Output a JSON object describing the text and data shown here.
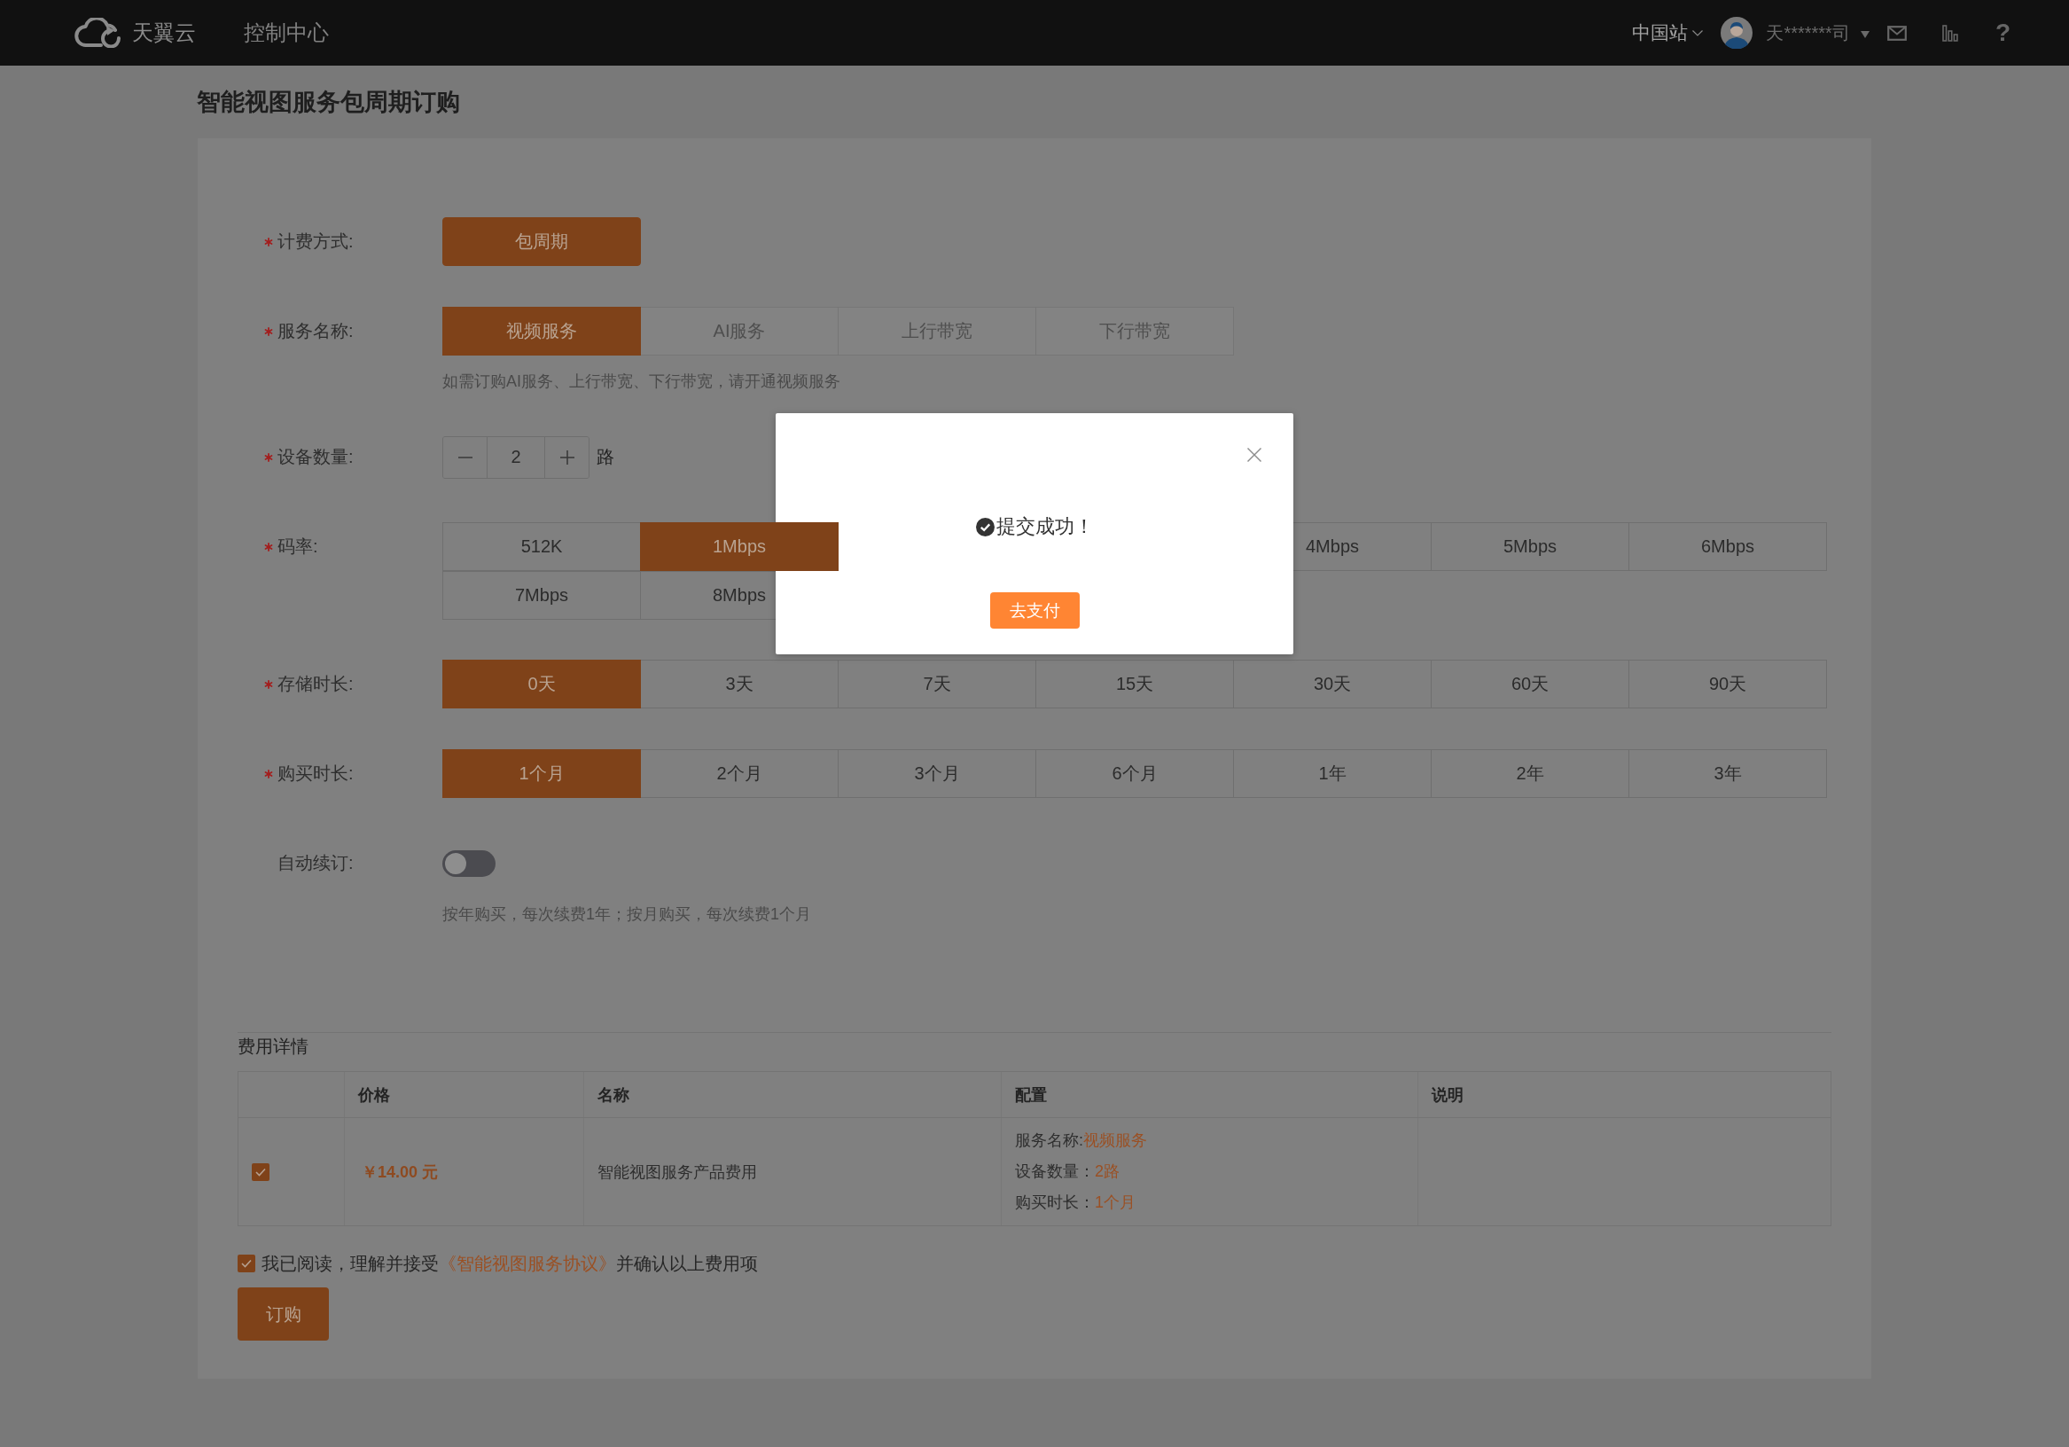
{
  "topbar": {
    "logo_text": "天翼云",
    "nav_title": "控制中心",
    "region": "中国站",
    "user": "天*******司",
    "help": "?"
  },
  "page_title": "智能视图服务包周期订购",
  "form": {
    "rows": [
      {
        "kind": "options",
        "label": "计费方式:",
        "required": true,
        "options": [
          {
            "label": "包周期",
            "selected": true
          }
        ]
      },
      {
        "kind": "options",
        "label": "服务名称:",
        "required": true,
        "options": [
          {
            "label": "视频服务",
            "selected": true,
            "disabled": false
          },
          {
            "label": "AI服务",
            "selected": false,
            "disabled": true
          },
          {
            "label": "上行带宽",
            "selected": false,
            "disabled": true
          },
          {
            "label": "下行带宽",
            "selected": false,
            "disabled": true
          }
        ],
        "hint": "如需订购AI服务、上行带宽、下行带宽，请开通视频服务"
      },
      {
        "kind": "stepper",
        "label": "设备数量:",
        "required": true,
        "value": "2",
        "unit": "路"
      },
      {
        "kind": "options",
        "label": "码率:",
        "required": true,
        "options": [
          {
            "kind": "option",
            "label": "512K",
            "selected": false
          },
          {
            "kind": "option",
            "label": "1Mbps",
            "selected": true
          },
          {
            "kind": "covered"
          },
          {
            "kind": "covered"
          },
          {
            "kind": "option",
            "label": "4Mbps",
            "selected": false
          },
          {
            "kind": "option",
            "label": "5Mbps",
            "selected": false
          },
          {
            "kind": "option",
            "label": "6Mbps",
            "selected": false
          },
          {
            "kind": "option",
            "label": "7Mbps",
            "selected": false
          },
          {
            "kind": "option",
            "label": "8Mbps",
            "selected": false
          }
        ]
      },
      {
        "kind": "options",
        "label": "存储时长:",
        "required": true,
        "options": [
          {
            "label": "0天",
            "selected": true
          },
          {
            "label": "3天",
            "selected": false
          },
          {
            "label": "7天",
            "selected": false
          },
          {
            "label": "15天",
            "selected": false
          },
          {
            "label": "30天",
            "selected": false
          },
          {
            "label": "60天",
            "selected": false
          },
          {
            "label": "90天",
            "selected": false
          }
        ]
      },
      {
        "kind": "options",
        "label": "购买时长:",
        "required": true,
        "options": [
          {
            "label": "1个月",
            "selected": true
          },
          {
            "label": "2个月",
            "selected": false
          },
          {
            "label": "3个月",
            "selected": false
          },
          {
            "label": "6个月",
            "selected": false
          },
          {
            "label": "1年",
            "selected": false
          },
          {
            "label": "2年",
            "selected": false
          },
          {
            "label": "3年",
            "selected": false
          }
        ]
      },
      {
        "kind": "switch",
        "label": "自动续订:",
        "required": false,
        "on": false,
        "hint": "按年购买，每次续费1年；按月购买，每次续费1个月"
      }
    ]
  },
  "fees": {
    "title": "费用详情",
    "columns": [
      "价格",
      "名称",
      "配置",
      "说明"
    ],
    "rows": [
      {
        "checked": true,
        "price": "￥14.00 元",
        "name": "智能视图服务产品费用",
        "config": [
          {
            "label": "服务名称:",
            "value": "视频服务"
          },
          {
            "label": "设备数量：",
            "value": "2路"
          },
          {
            "label": "购买时长：",
            "value": "1个月"
          }
        ]
      }
    ]
  },
  "agreement": {
    "checked": true,
    "text_before": "我已阅读，理解并接受",
    "link": "《智能视图服务协议》",
    "text_after": "并确认以上费用项"
  },
  "order_button": "订购",
  "dialog": {
    "message": "提交成功！",
    "button": "去支付"
  }
}
